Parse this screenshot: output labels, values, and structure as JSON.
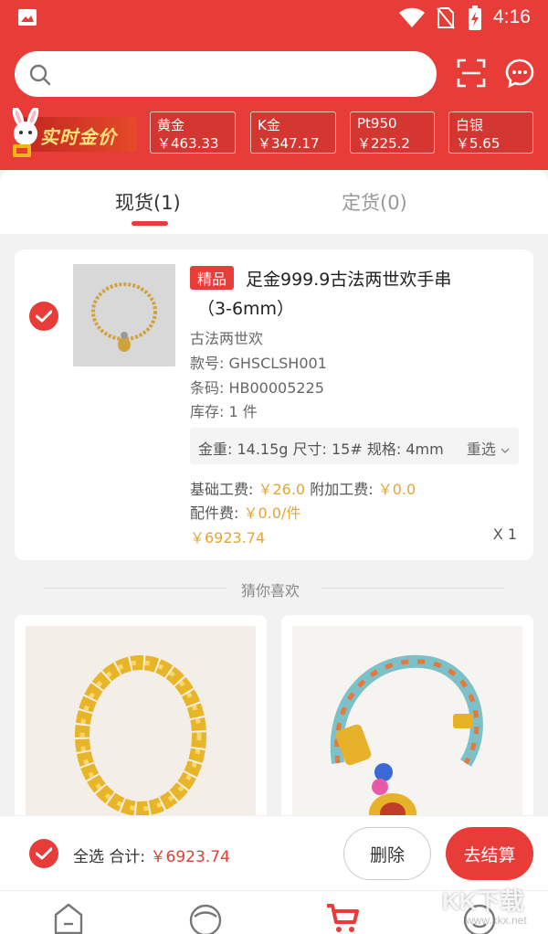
{
  "status": {
    "time": "4:16"
  },
  "search": {
    "placeholder": ""
  },
  "realtime": {
    "label": "实时金价"
  },
  "prices": [
    {
      "name": "黄金",
      "value": "￥463.33"
    },
    {
      "name": "K金",
      "value": "￥347.17"
    },
    {
      "name": "Pt950",
      "value": "￥225.2"
    },
    {
      "name": "白银",
      "value": "￥5.65"
    }
  ],
  "tabs": {
    "spot": "现货(1)",
    "order": "定货(0)"
  },
  "item": {
    "badge": "精品",
    "title_line1": "足金999.9古法两世欢手串",
    "title_line2": "（3-6mm）",
    "series": "古法两世欢",
    "style_no": "款号: GHSCLSH001",
    "barcode": "条码: HB00005225",
    "stock": "库存: 1 件",
    "spec": "金重: 14.15g 尺寸: 15# 规格: 4mm",
    "reselect": "重选",
    "base_fee_label": "基础工费: ",
    "base_fee": "￥26.0",
    "extra_fee_label": " 附加工费: ",
    "extra_fee": "￥0.0",
    "parts_fee_label": "配件费: ",
    "parts_fee": "￥0.0/件",
    "price": "￥6923.74",
    "qty": "X 1"
  },
  "recommend": {
    "title": "猜你喜欢"
  },
  "footer": {
    "select_all": "全选 合计: ",
    "total": "￥6923.74",
    "delete": "删除",
    "checkout": "去结算"
  },
  "watermark": {
    "text": "KK下载",
    "sub": "www.kkx.net"
  },
  "colors": {
    "brand": "#e73c37",
    "price": "#e4a537"
  }
}
